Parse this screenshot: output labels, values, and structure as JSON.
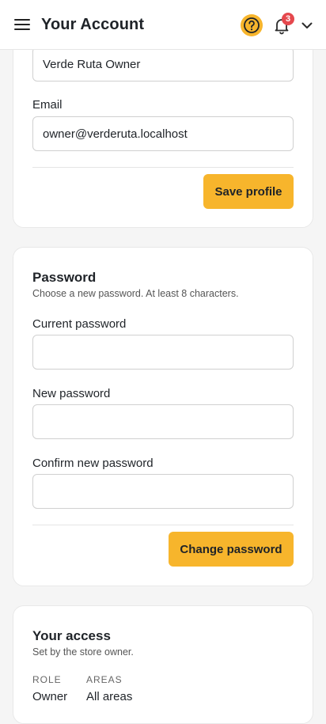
{
  "header": {
    "title": "Your Account",
    "notification_count": "3",
    "icons": {
      "menu": "hamburger-menu-icon",
      "help": "help-circle-icon",
      "notifications": "bell-icon",
      "account_menu": "chevron-down-icon"
    }
  },
  "colors": {
    "accent": "#f7b52c",
    "badge": "#e5484d"
  },
  "profile": {
    "name_value": "Verde Ruta Owner",
    "email_label": "Email",
    "email_value": "owner@verderuta.localhost",
    "save_label": "Save profile"
  },
  "password": {
    "title": "Password",
    "subtitle": "Choose a new password. At least 8 characters.",
    "current_label": "Current password",
    "current_value": "",
    "new_label": "New password",
    "new_value": "",
    "confirm_label": "Confirm new password",
    "confirm_value": "",
    "submit_label": "Change password"
  },
  "access": {
    "title": "Your access",
    "subtitle": "Set by the store owner.",
    "role_key": "ROLE",
    "role_value": "Owner",
    "areas_key": "AREAS",
    "areas_value": "All areas"
  }
}
